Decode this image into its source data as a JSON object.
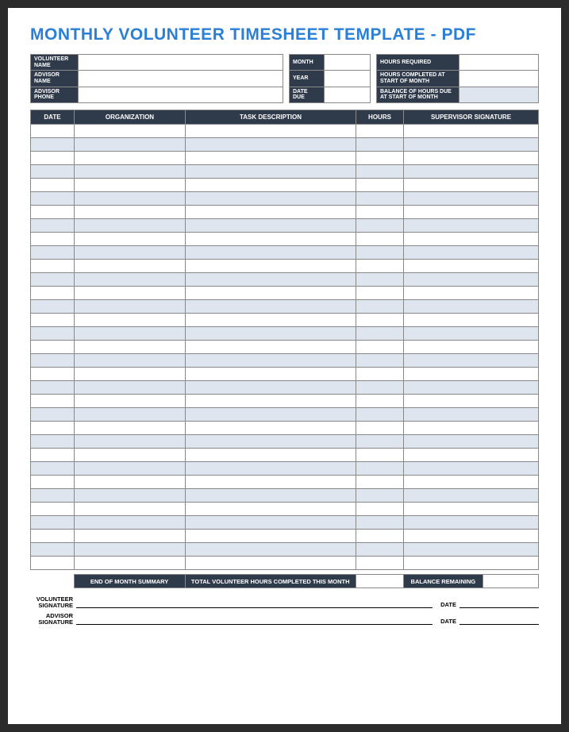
{
  "title": "MONTHLY VOLUNTEER TIMESHEET TEMPLATE - PDF",
  "info": {
    "volunteer_name_label": "VOLUNTEER NAME",
    "advisor_name_label": "ADVISOR NAME",
    "advisor_phone_label": "ADVISOR PHONE",
    "month_label": "MONTH",
    "year_label": "YEAR",
    "date_due_label": "DATE DUE",
    "hours_required_label": "HOURS REQUIRED",
    "hours_completed_label": "HOURS COMPLETED AT START OF MONTH",
    "balance_due_label": "BALANCE OF HOURS DUE AT START OF MONTH",
    "volunteer_name": "",
    "advisor_name": "",
    "advisor_phone": "",
    "month": "",
    "year": "",
    "date_due": "",
    "hours_required": "",
    "hours_completed": "",
    "balance_due": ""
  },
  "columns": {
    "date": "DATE",
    "organization": "ORGANIZATION",
    "task": "TASK DESCRIPTION",
    "hours": "HOURS",
    "signature": "SUPERVISOR SIGNATURE"
  },
  "rows": [
    {
      "date": "",
      "org": "",
      "task": "",
      "hours": "",
      "sig": ""
    },
    {
      "date": "",
      "org": "",
      "task": "",
      "hours": "",
      "sig": ""
    },
    {
      "date": "",
      "org": "",
      "task": "",
      "hours": "",
      "sig": ""
    },
    {
      "date": "",
      "org": "",
      "task": "",
      "hours": "",
      "sig": ""
    },
    {
      "date": "",
      "org": "",
      "task": "",
      "hours": "",
      "sig": ""
    },
    {
      "date": "",
      "org": "",
      "task": "",
      "hours": "",
      "sig": ""
    },
    {
      "date": "",
      "org": "",
      "task": "",
      "hours": "",
      "sig": ""
    },
    {
      "date": "",
      "org": "",
      "task": "",
      "hours": "",
      "sig": ""
    },
    {
      "date": "",
      "org": "",
      "task": "",
      "hours": "",
      "sig": ""
    },
    {
      "date": "",
      "org": "",
      "task": "",
      "hours": "",
      "sig": ""
    },
    {
      "date": "",
      "org": "",
      "task": "",
      "hours": "",
      "sig": ""
    },
    {
      "date": "",
      "org": "",
      "task": "",
      "hours": "",
      "sig": ""
    },
    {
      "date": "",
      "org": "",
      "task": "",
      "hours": "",
      "sig": ""
    },
    {
      "date": "",
      "org": "",
      "task": "",
      "hours": "",
      "sig": ""
    },
    {
      "date": "",
      "org": "",
      "task": "",
      "hours": "",
      "sig": ""
    },
    {
      "date": "",
      "org": "",
      "task": "",
      "hours": "",
      "sig": ""
    },
    {
      "date": "",
      "org": "",
      "task": "",
      "hours": "",
      "sig": ""
    },
    {
      "date": "",
      "org": "",
      "task": "",
      "hours": "",
      "sig": ""
    },
    {
      "date": "",
      "org": "",
      "task": "",
      "hours": "",
      "sig": ""
    },
    {
      "date": "",
      "org": "",
      "task": "",
      "hours": "",
      "sig": ""
    },
    {
      "date": "",
      "org": "",
      "task": "",
      "hours": "",
      "sig": ""
    },
    {
      "date": "",
      "org": "",
      "task": "",
      "hours": "",
      "sig": ""
    },
    {
      "date": "",
      "org": "",
      "task": "",
      "hours": "",
      "sig": ""
    },
    {
      "date": "",
      "org": "",
      "task": "",
      "hours": "",
      "sig": ""
    },
    {
      "date": "",
      "org": "",
      "task": "",
      "hours": "",
      "sig": ""
    },
    {
      "date": "",
      "org": "",
      "task": "",
      "hours": "",
      "sig": ""
    },
    {
      "date": "",
      "org": "",
      "task": "",
      "hours": "",
      "sig": ""
    },
    {
      "date": "",
      "org": "",
      "task": "",
      "hours": "",
      "sig": ""
    },
    {
      "date": "",
      "org": "",
      "task": "",
      "hours": "",
      "sig": ""
    },
    {
      "date": "",
      "org": "",
      "task": "",
      "hours": "",
      "sig": ""
    },
    {
      "date": "",
      "org": "",
      "task": "",
      "hours": "",
      "sig": ""
    },
    {
      "date": "",
      "org": "",
      "task": "",
      "hours": "",
      "sig": ""
    },
    {
      "date": "",
      "org": "",
      "task": "",
      "hours": "",
      "sig": ""
    }
  ],
  "summary": {
    "end_label": "END OF MONTH SUMMARY",
    "total_label": "TOTAL VOLUNTEER HOURS COMPLETED THIS MONTH",
    "balance_label": "BALANCE REMAINING",
    "total_value": "",
    "balance_value": ""
  },
  "signatures": {
    "volunteer_label": "VOLUNTEER SIGNATURE",
    "advisor_label": "ADVISOR SIGNATURE",
    "date_label": "DATE"
  }
}
